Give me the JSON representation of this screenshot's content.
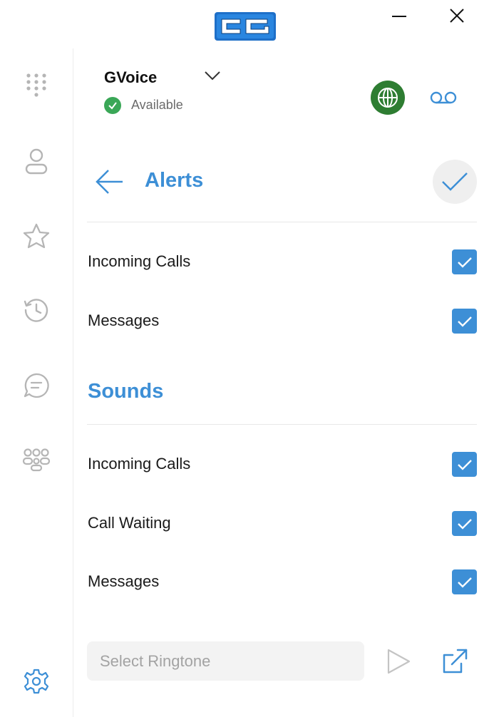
{
  "titlebar": {
    "logo_icon": "cc-logo-icon",
    "minimize_icon": "minimize-icon",
    "close_icon": "close-icon"
  },
  "sidebar": {
    "items": [
      {
        "name": "dialpad",
        "icon": "dialpad-icon"
      },
      {
        "name": "contacts",
        "icon": "person-icon"
      },
      {
        "name": "favorites",
        "icon": "star-icon"
      },
      {
        "name": "history",
        "icon": "history-icon"
      },
      {
        "name": "messages",
        "icon": "chat-icon"
      },
      {
        "name": "groups",
        "icon": "group-icon"
      },
      {
        "name": "settings",
        "icon": "gear-icon"
      }
    ]
  },
  "account": {
    "name": "GVoice",
    "status": "Available"
  },
  "header_actions": {
    "globe_icon": "globe-icon",
    "voicemail_icon": "voicemail-icon"
  },
  "page": {
    "title": "Alerts"
  },
  "alerts": {
    "items": [
      {
        "label": "Incoming Calls",
        "checked": true
      },
      {
        "label": "Messages",
        "checked": true
      }
    ]
  },
  "sounds": {
    "title": "Sounds",
    "items": [
      {
        "label": "Incoming Calls",
        "checked": true
      },
      {
        "label": "Call Waiting",
        "checked": true
      },
      {
        "label": "Messages",
        "checked": true
      }
    ]
  },
  "ringtone": {
    "placeholder": "Select Ringtone",
    "value": ""
  },
  "colors": {
    "accent": "#3d8fd6",
    "status_green": "#3aa757",
    "globe_bg": "#2e7d32"
  }
}
